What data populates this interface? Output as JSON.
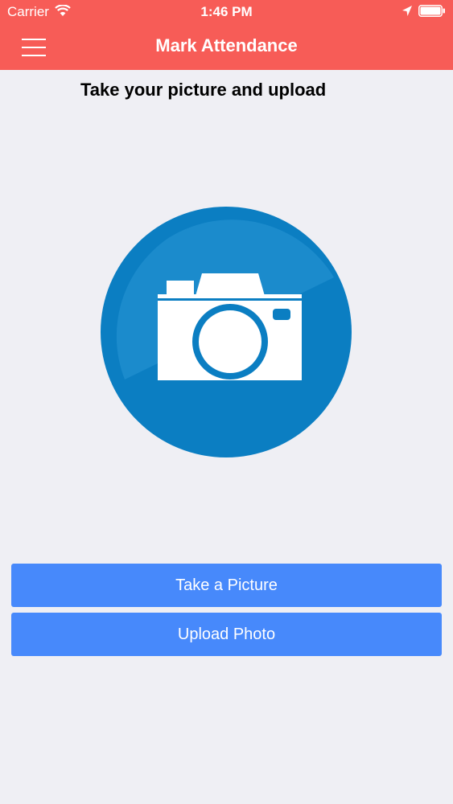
{
  "status_bar": {
    "carrier": "Carrier",
    "time": "1:46 PM",
    "icons": [
      "wifi-icon",
      "location-arrow-icon",
      "battery-icon"
    ]
  },
  "header": {
    "title": "Mark Attendance",
    "menu_icon": "hamburger-menu-icon"
  },
  "main": {
    "instruction": "Take your picture and upload",
    "graphic_icon": "camera-icon",
    "buttons": {
      "take_picture": "Take a Picture",
      "upload_photo": "Upload Photo"
    }
  },
  "colors": {
    "header_background": "#f75c57",
    "page_background": "#efeff4",
    "button_background": "#4789fb",
    "camera_circle": "#1388cc",
    "white": "#ffffff"
  }
}
